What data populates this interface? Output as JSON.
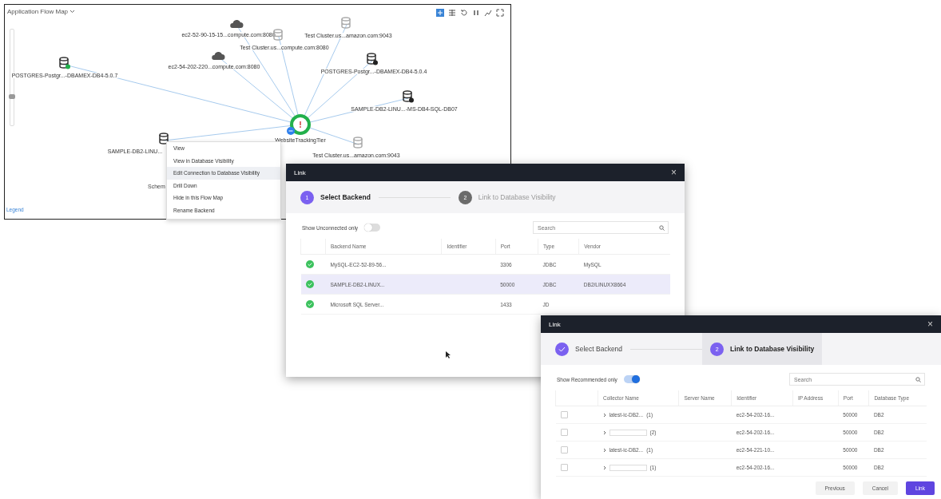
{
  "flow_map": {
    "title": "Application Flow Map",
    "legend": "Legend",
    "partial_label": "Schem",
    "zoom_slider": {
      "level": 0.3
    },
    "center": {
      "label": "WebsiteTrackingTier",
      "alert": true
    },
    "nodes": [
      {
        "kind": "cloud",
        "label": "ec2-52-90-15-15...compute.com:8080"
      },
      {
        "kind": "faded-database",
        "label": "Test Cluster.us...compute.com:8080"
      },
      {
        "kind": "faded-database",
        "label": "Test Cluster.us...amazon.com:9043"
      },
      {
        "kind": "cloud",
        "label": "ec2-54-202-220...compute.com:8080"
      },
      {
        "kind": "database",
        "label": "POSTGRES-Postgr...-DBAMEX-DB4-5.0.4",
        "color": "#222222"
      },
      {
        "kind": "database",
        "label": "POSTGRES-Postgr...-DBAMEX-DB4-5.0.7",
        "color": "#22b04b"
      },
      {
        "kind": "database",
        "label": "SAMPLE-DB2-LINU...-MS-DB4-SQL-DB07",
        "color": "#222222"
      },
      {
        "kind": "faded-database",
        "label": "Test Cluster.us...amazon.com:9043"
      },
      {
        "kind": "database",
        "label": "SAMPLE-DB2-LINU..."
      }
    ]
  },
  "context_menu": {
    "items": [
      {
        "label": "View",
        "hovered": false
      },
      {
        "label": "View in Database Visibility",
        "hovered": false
      },
      {
        "label": "Edit Connection to Database Visibility",
        "hovered": true
      },
      {
        "label": "Drill Down",
        "hovered": false
      },
      {
        "label": "Hide in this Flow Map",
        "hovered": false
      },
      {
        "label": "Rename Backend",
        "hovered": false
      }
    ]
  },
  "dialogs": [
    {
      "title": "Link",
      "close": "×",
      "steps": [
        {
          "number": "1",
          "label": "Select Backend",
          "selected": true,
          "completed": false
        },
        {
          "number": "2",
          "label": "Link to Database Visibility",
          "selected": false,
          "completed": false
        }
      ],
      "toggle": {
        "label": "Show Unconnected only",
        "on": false
      },
      "search": {
        "placeholder": "Search"
      },
      "columns": [
        "Backend Name",
        "Identifier",
        "Port",
        "Type",
        "Vendor"
      ],
      "rows": [
        {
          "selected": false,
          "cells": [
            "MySQL-EC2-52-89-56...",
            "",
            "3306",
            "JDBC",
            "MySQL"
          ]
        },
        {
          "selected": true,
          "cells": [
            "SAMPLE-DB2-LINUX...",
            "",
            "50000",
            "JDBC",
            "DB2/LINUXX8664"
          ]
        },
        {
          "selected": false,
          "cells": [
            "Microsoft SQL Server...",
            "",
            "1433",
            "JD",
            ""
          ]
        }
      ]
    },
    {
      "title": "Link",
      "close": "×",
      "steps": [
        {
          "label": "Select Backend",
          "selected": false,
          "completed": true
        },
        {
          "number": "2",
          "label": "Link to Database Visibility",
          "selected": true,
          "completed": false
        }
      ],
      "toggle": {
        "label": "Show Recommended only",
        "on": true
      },
      "search": {
        "placeholder": "Search"
      },
      "columns": [
        "Collector Name",
        "Server Name",
        "Identifier",
        "IP Address",
        "Port",
        "Database Type"
      ],
      "rows": [
        {
          "selected": false,
          "count": "(1)",
          "cells": [
            "latest-ic-DB2...",
            "",
            "ec2-54-202-16...",
            "",
            "50000",
            "DB2"
          ]
        },
        {
          "selected": false,
          "count": "(2)",
          "cells": [
            "",
            "",
            "ec2-54-202-16...",
            "",
            "50000",
            "DB2"
          ]
        },
        {
          "selected": false,
          "count": "(1)",
          "cells": [
            "latest-ic-DB2...",
            "",
            "ec2-54-221-10...",
            "",
            "50000",
            "DB2"
          ]
        },
        {
          "selected": false,
          "count": "(1)",
          "cells": [
            "",
            "",
            "ec2-54-202-16...",
            "",
            "50000",
            "DB2"
          ]
        }
      ],
      "buttons": [
        {
          "label": "Previous",
          "kind": "secondary"
        },
        {
          "label": "Cancel",
          "kind": "secondary"
        },
        {
          "label": "Link",
          "kind": "primary"
        }
      ]
    }
  ]
}
